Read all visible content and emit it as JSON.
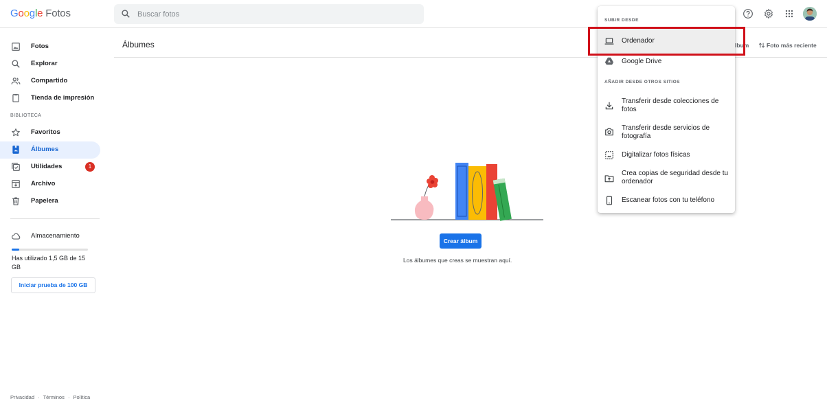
{
  "app": {
    "logo": {
      "letters": [
        "G",
        "o",
        "o",
        "g",
        "l",
        "e"
      ],
      "product": "Fotos"
    }
  },
  "search": {
    "placeholder": "Buscar fotos"
  },
  "header_icons": [
    "help-icon",
    "settings-icon",
    "apps-icon",
    "avatar"
  ],
  "sidebar": {
    "items": [
      {
        "label": "Fotos",
        "icon": "photo-icon"
      },
      {
        "label": "Explorar",
        "icon": "search-icon"
      },
      {
        "label": "Compartido",
        "icon": "people-icon"
      },
      {
        "label": "Tienda de impresión",
        "icon": "print-store-icon"
      }
    ],
    "library_label": "BIBLIOTECA",
    "library_items": [
      {
        "label": "Favoritos",
        "icon": "star-icon"
      },
      {
        "label": "Álbumes",
        "icon": "album-icon",
        "active": true
      },
      {
        "label": "Utilidades",
        "icon": "utilities-icon",
        "badge": "1"
      },
      {
        "label": "Archivo",
        "icon": "archive-icon"
      },
      {
        "label": "Papelera",
        "icon": "trash-icon"
      }
    ],
    "storage": {
      "label": "Almacenamiento",
      "used_text": "Has utilizado 1,5 GB de 15 GB",
      "used_fraction": 0.1,
      "trial_button": "Iniciar prueba de 100 GB"
    },
    "footer": [
      "Privacidad",
      "·",
      "Términos",
      "·",
      "Política"
    ]
  },
  "main": {
    "title": "Álbumes",
    "album_partial": "lbum",
    "sort_label": "Foto más reciente",
    "create_button": "Crear álbum",
    "empty_text": "Los álbumes que creas se muestran aquí."
  },
  "upload_menu": {
    "section_upload": "SUBIR DESDE",
    "upload_items": [
      {
        "label": "Ordenador",
        "icon": "laptop-icon",
        "highlighted": true
      },
      {
        "label": "Google Drive",
        "icon": "drive-icon"
      }
    ],
    "section_other": "AÑADIR DESDE OTROS SITIOS",
    "other_items": [
      {
        "label": "Transferir desde colecciones de fotos",
        "icon": "download-icon"
      },
      {
        "label": "Transferir desde servicios de fotografía",
        "icon": "camera-icon"
      },
      {
        "label": "Digitalizar fotos físicas",
        "icon": "scan-photo-icon"
      },
      {
        "label": "Crea copias de seguridad desde tu ordenador",
        "icon": "backup-folder-icon"
      },
      {
        "label": "Escanear fotos con tu teléfono",
        "icon": "phone-icon"
      }
    ]
  },
  "colors": {
    "accent": "#1a73e8",
    "active_bg": "#e8f0fe",
    "highlight_box": "#d0111a",
    "badge": "#d93025"
  }
}
